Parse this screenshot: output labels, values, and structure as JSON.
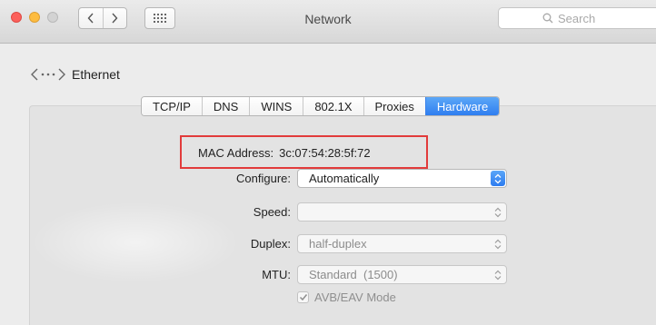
{
  "window": {
    "title": "Network"
  },
  "toolbar": {
    "search_placeholder": "Search"
  },
  "breadcrumb": {
    "label": "Ethernet"
  },
  "tabs": [
    {
      "label": "TCP/IP",
      "active": false
    },
    {
      "label": "DNS",
      "active": false
    },
    {
      "label": "WINS",
      "active": false
    },
    {
      "label": "802.1X",
      "active": false
    },
    {
      "label": "Proxies",
      "active": false
    },
    {
      "label": "Hardware",
      "active": true
    }
  ],
  "hardware": {
    "mac_label": "MAC Address:",
    "mac_value": "3c:07:54:28:5f:72",
    "configure": {
      "label": "Configure:",
      "value": "Automatically"
    },
    "speed": {
      "label": "Speed:",
      "value": ""
    },
    "duplex": {
      "label": "Duplex:",
      "value": "half-duplex"
    },
    "mtu": {
      "label": "MTU:",
      "value": "Standard  (1500)"
    },
    "avb": {
      "label": "AVB/EAV Mode",
      "checked": true
    }
  },
  "colors": {
    "accent": "#2f7ef0",
    "highlight_box": "#e23b3b"
  }
}
